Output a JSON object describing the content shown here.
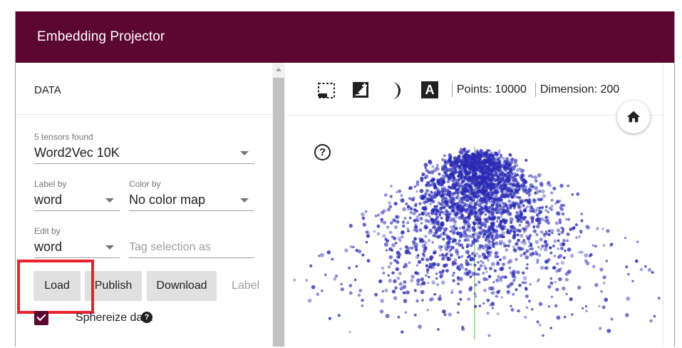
{
  "app": {
    "title": "Embedding Projector"
  },
  "data_panel": {
    "section_title": "DATA",
    "tensors_label": "5 tensors found",
    "tensor_value": "Word2Vec 10K",
    "label_by": {
      "label": "Label by",
      "value": "word"
    },
    "color_by": {
      "label": "Color by",
      "value": "No color map"
    },
    "edit_by": {
      "label": "Edit by",
      "value": "word"
    },
    "tag_placeholder": "Tag selection as",
    "buttons": {
      "load": "Load",
      "publish": "Publish",
      "download": "Download",
      "label": "Label"
    },
    "spherize_label": "Sphereize data",
    "spherize_checked": true,
    "help_glyph": "?"
  },
  "toolbar": {
    "icons": [
      "select-rectangle-icon",
      "edit-label-icon",
      "night-mode-icon",
      "label-toggle-icon"
    ],
    "label_toggle_glyph": "A",
    "points_text": "Points: 10000",
    "dimension_text": "Dimension: 200"
  },
  "projection": {
    "help_glyph": "?",
    "home_icon": "home-icon",
    "point_color": "#2a2ab4"
  },
  "colors": {
    "header_bg": "#5c0632",
    "accent": "#5c0632",
    "highlight": "#e8232e",
    "axis_line": "#8bd17c"
  }
}
